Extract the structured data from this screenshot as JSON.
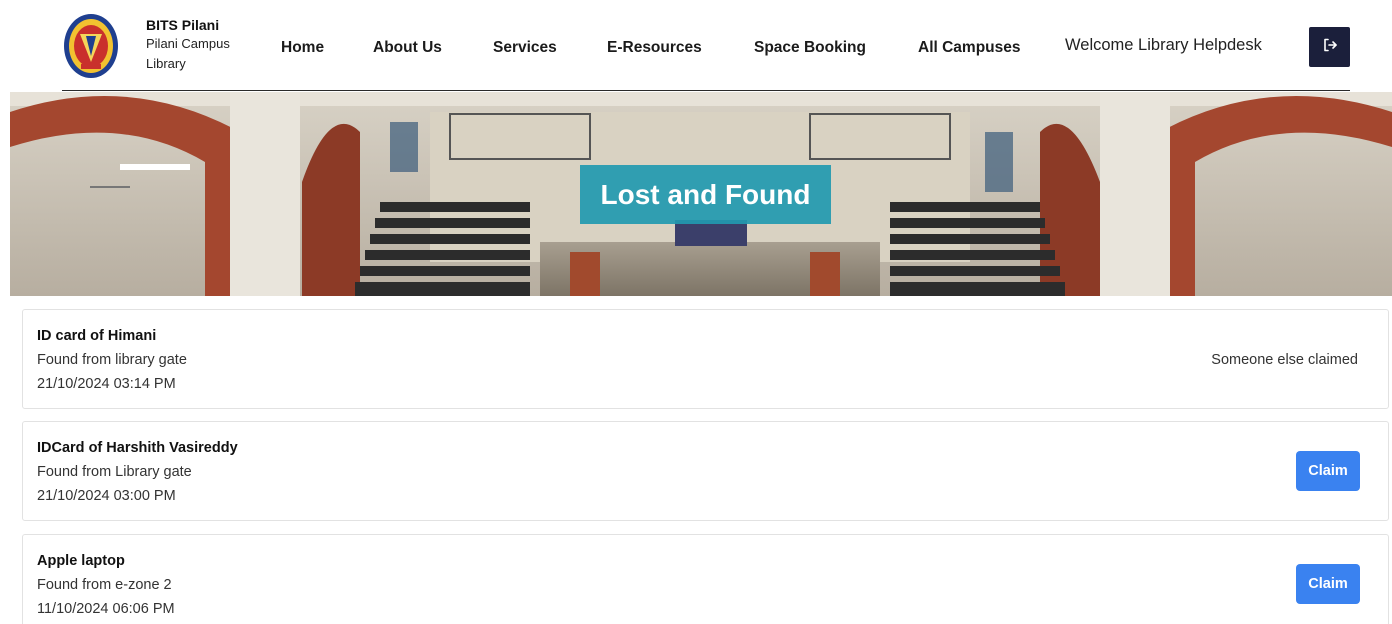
{
  "header": {
    "brand_title": "BITS Pilani",
    "brand_sub_1": "Pilani Campus",
    "brand_sub_2": "Library",
    "nav": [
      "Home",
      "About Us",
      "Services",
      "E-Resources",
      "Space Booking",
      "All Campuses"
    ],
    "welcome": "Welcome Library Helpdesk",
    "logout_icon": "logout-icon"
  },
  "banner": {
    "title": "Lost and Found"
  },
  "items": [
    {
      "title": "ID card of Himani",
      "location": "Found from library gate",
      "datetime": "21/10/2024 03:14 PM",
      "status": "Someone else claimed"
    },
    {
      "title": "IDCard of Harshith Vasireddy",
      "location": "Found from Library gate",
      "datetime": "21/10/2024 03:00 PM",
      "action": "Claim"
    },
    {
      "title": "Apple laptop",
      "location": "Found from e-zone 2",
      "datetime": "11/10/2024 06:06 PM",
      "action": "Claim"
    }
  ],
  "colors": {
    "accent_teal": "#2299b0",
    "claim_blue": "#3a82f0",
    "logout_navy": "#1b1f3b"
  }
}
